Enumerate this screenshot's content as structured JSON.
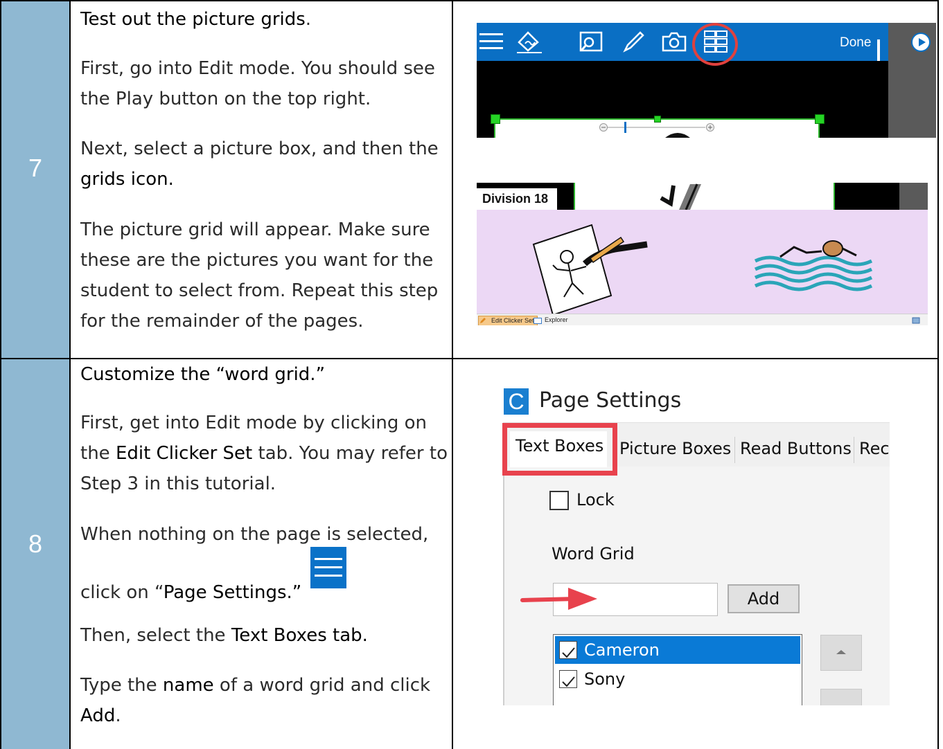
{
  "rows": [
    {
      "step": "7",
      "title_pre": "Test out the picture grids",
      "title_post": ".",
      "para1": "First, go into Edit mode. You should see the Play button on the top right.",
      "para2_pre": "Next, select a picture box, and then the",
      "para2_kw": "grids icon.",
      "para3": "The picture grid will appear. Make sure these are the pictures you want for the student to select from. Repeat this step for the remainder of the pages."
    },
    {
      "step": "8",
      "title": "Customize the “word grid.”",
      "para1_pre": "First, get into Edit mode by clicking on the",
      "para1_kw": "Edit Clicker Set",
      "para1_post": "tab. You may refer to Step 3 in this tutorial.",
      "para2_line1": "When nothing on the page is selected,",
      "para2_pre": "click on “",
      "para2_kw": "Page Settings.”",
      "para3_pre": "Then, select the",
      "para3_kw": "Text Boxes tab.",
      "para4_pre": "Type the",
      "para4_kw": "name",
      "para4_mid": "of a word grid and click",
      "para4_kw2": "Add",
      "para4_post": "."
    }
  ],
  "toolbar_shot": {
    "done_label": "Done",
    "icons": [
      "menu-icon",
      "edit-page-icon",
      "picture-search-icon",
      "pen-icon",
      "camera-icon",
      "grids-icon",
      "play-icon"
    ],
    "highlight_color": "#e0413e",
    "bar_color": "#0a6fc4"
  },
  "division_shot": {
    "label": "Division 18",
    "status_tabs": [
      "Edit Clicker Set",
      "Explorer"
    ],
    "pictures": [
      "drawing-symbol",
      "swimming-symbol"
    ]
  },
  "settings_shot": {
    "app_logo": "C",
    "title": "Page Settings",
    "tabs": [
      "Text Boxes",
      "Picture Boxes",
      "Read Buttons",
      "Rec"
    ],
    "active_tab": "Text Boxes",
    "lock_label": "Lock",
    "word_grid_label": "Word Grid",
    "add_label": "Add",
    "input_value": "",
    "list": [
      {
        "label": "Cameron",
        "checked": true,
        "selected": true
      },
      {
        "label": "Sony",
        "checked": true,
        "selected": false
      }
    ],
    "highlight_color": "#e8424d"
  }
}
